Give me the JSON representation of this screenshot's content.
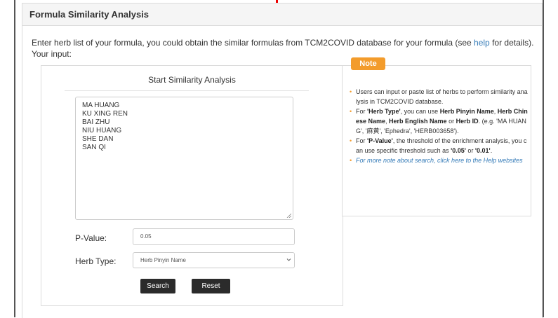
{
  "panel": {
    "title": "Formula Similarity Analysis",
    "intro_before_link": "Enter herb list of your formula, you could obtain the similar formulas from TCM2COVID database for your formula (see ",
    "help_link": "help",
    "intro_after_link": " for details).",
    "your_input_label": "Your input:"
  },
  "form": {
    "title": "Start Similarity Analysis",
    "herbs": [
      "MA HUANG",
      "KU XING REN",
      "BAI ZHU",
      "NIU HUANG",
      "SHE DAN",
      "SAN QI"
    ],
    "pvalue_label": "P-Value:",
    "pvalue_value": "0.05",
    "herbtype_label": "Herb Type:",
    "herbtype_selected": "Herb Pinyin Name",
    "search_button": "Search",
    "reset_button": "Reset"
  },
  "note": {
    "badge": "Note",
    "item1": "Users can input or paste list of herbs to perform similarity analysis in TCM2COVID database.",
    "item2_prefix": "For ",
    "item2_herb_type": "'Herb Type'",
    "item2_mid1": ", you can use ",
    "item2_pinyin": "Herb Pinyin Name",
    "item2_comma1": ", ",
    "item2_chinese": "Herb Chinese Name",
    "item2_comma2": ", ",
    "item2_english": "Herb English Name",
    "item2_or": " or ",
    "item2_id": "Herb ID",
    "item2_example": ". (e.g. 'MA HUANG', '麻黄', 'Ephedra', 'HERB003658').",
    "item3_prefix": "For ",
    "item3_pvalue": "'P-Value'",
    "item3_mid": ", the threshold of the enrichment analysis, you can use specific threshold such as ",
    "item3_005": "'0.05'",
    "item3_or": " or ",
    "item3_001": "'0.01'",
    "item3_end": ".",
    "item4_link": "For more note about search, click here to the Help websites"
  },
  "colors": {
    "accent": "#f39c2c",
    "link": "#337ab7",
    "button": "#2b2b2b"
  }
}
